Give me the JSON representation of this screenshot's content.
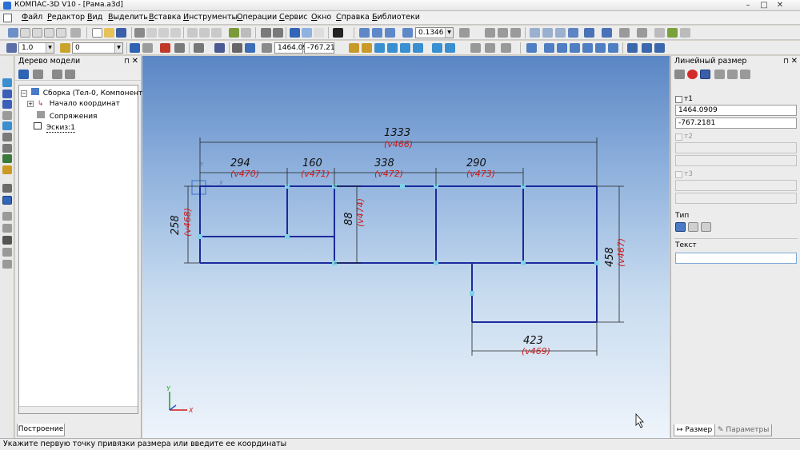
{
  "window": {
    "title": "КОМПАС-3D V10 - [Рама.a3d]"
  },
  "menu": [
    "Файл",
    "Редактор",
    "Вид",
    "Выделить",
    "Вставка",
    "Инструменты",
    "Операции",
    "Сервис",
    "Окно",
    "Справка",
    "Библиотеки"
  ],
  "toolbar": {
    "zoom_value": "0.1346",
    "step_value": "1.0",
    "layer_value": "0",
    "coord_x": "1464.09",
    "coord_y": "-767.21"
  },
  "tree": {
    "title": "Дерево модели",
    "items": [
      "Сборка (Тел-0, Компонентов-0)",
      "Начало координат",
      "Сопряжения",
      "Эскиз:1"
    ],
    "tab": "Построение"
  },
  "props": {
    "title": "Линейный размер",
    "t1_label": "т1",
    "t1_x": "1464.0909",
    "t1_y": "-767.2181",
    "t2_label": "т2",
    "t3_label": "т3",
    "type_label": "Тип",
    "text_label": "Текст",
    "tab_size": "Размер",
    "tab_params": "Параметры"
  },
  "drawing": {
    "dims": [
      {
        "value": "1333",
        "var": "(v466)"
      },
      {
        "value": "294",
        "var": "(v470)"
      },
      {
        "value": "160",
        "var": "(v471)"
      },
      {
        "value": "338",
        "var": "(v472)"
      },
      {
        "value": "290",
        "var": "(v473)"
      },
      {
        "value": "258",
        "var": "(v468)"
      },
      {
        "value": "88",
        "var": "(v474)"
      },
      {
        "value": "458",
        "var": "(v467)"
      },
      {
        "value": "423",
        "var": "(v469)"
      }
    ],
    "axis_x": "X",
    "axis_y": "Y",
    "origin_x": "X",
    "origin_y": "Y"
  },
  "status": "Укажите первую точку привязки размера или введите ее координаты",
  "colors": {
    "sketch_line": "#1b2a9c",
    "dimension_text": "#111111",
    "variable_text": "#d01818",
    "canvas_top": "#5a86c4",
    "canvas_bottom": "#eef4fb"
  }
}
